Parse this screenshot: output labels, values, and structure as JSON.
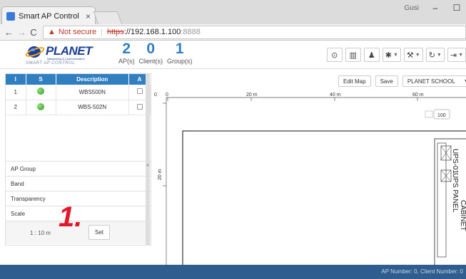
{
  "browser": {
    "tab_title": "Smart AP Control",
    "tab_close": "×",
    "window_user": "Gusi",
    "window_minimize": "–",
    "window_maximize": "☐",
    "nav_back": "←",
    "nav_forward": "→",
    "nav_reload": "C",
    "security_warning": "Not secure",
    "url_scheme": "https",
    "url_host": "://192.168.1.100",
    "url_port": ":8888"
  },
  "app": {
    "logo_name": "PLANET",
    "logo_subtitle": "Networking & Communication",
    "logo_tagline": "SMART AP CONTROL",
    "counters": [
      {
        "value": "2",
        "label": "AP(s)"
      },
      {
        "value": "0",
        "label": "Client(s)"
      },
      {
        "value": "1",
        "label": "Group(s)"
      }
    ],
    "toolbar": [
      {
        "icon": "dashboard-icon",
        "glyph": "⊙"
      },
      {
        "icon": "bar-chart-icon",
        "glyph": "▥"
      },
      {
        "icon": "user-group-icon",
        "glyph": "♟"
      },
      {
        "icon": "settings-icon",
        "glyph": "✱"
      },
      {
        "icon": "wrench-icon",
        "glyph": "⚒"
      },
      {
        "icon": "refresh-icon",
        "glyph": "↻"
      },
      {
        "icon": "logout-icon",
        "glyph": "⇥"
      }
    ]
  },
  "ap_table": {
    "headers": [
      "I",
      "S",
      "Description",
      "A"
    ],
    "rows": [
      {
        "index": "1",
        "description": "WBS500N"
      },
      {
        "index": "2",
        "description": "WBS-502N"
      }
    ]
  },
  "accordion": {
    "ap_group": "AP Group",
    "band": "Band",
    "transparency": "Transparency",
    "scale": "Scale",
    "scale_value": "1 : 10 m",
    "set_label": "Set",
    "step_label": "1."
  },
  "map": {
    "edit_map": "Edit Map",
    "save": "Save",
    "school": "PLANET SCHOOL",
    "ruler_x": [
      "0",
      "0",
      "20 m",
      "40 m",
      "60 m"
    ],
    "ruler_y": "20 m",
    "zoom": "100",
    "labels": {
      "ups": "UPS-01",
      "cabinet": "CABINET",
      "panel": "UPS PANEL"
    }
  },
  "footer": {
    "status": "AP Number: 0, Client Number: 0"
  }
}
